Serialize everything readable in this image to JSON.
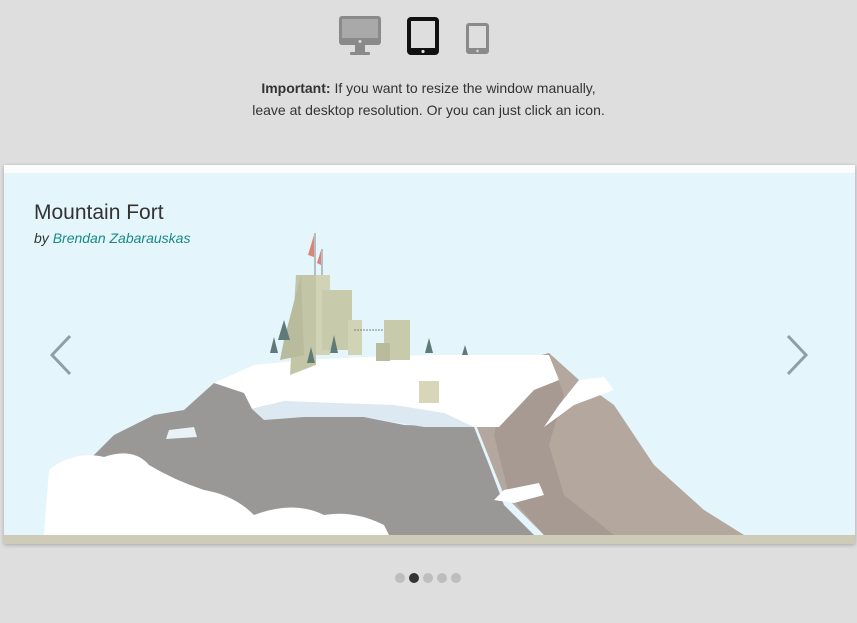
{
  "device_switcher": {
    "items": [
      {
        "name": "desktop",
        "icon": "desktop-monitor-icon",
        "active": false,
        "color": "#8a8a8a"
      },
      {
        "name": "tablet",
        "icon": "tablet-icon",
        "active": true,
        "color": "#111111"
      },
      {
        "name": "phone",
        "icon": "phone-icon",
        "active": false,
        "color": "#8a8a8a"
      }
    ]
  },
  "notice": {
    "strong": "Important:",
    "line1": "If you want to resize the window manually,",
    "line2": "leave at desktop resolution. Or you can just click an icon."
  },
  "slide": {
    "title": "Mountain Fort",
    "by_prefix": "by",
    "author": "Brendan Zabarauskas",
    "author_color": "#1a8a86"
  },
  "navigation": {
    "prev_icon": "chevron-left-icon",
    "next_icon": "chevron-right-icon"
  },
  "pagination": {
    "total": 5,
    "active_index": 1
  },
  "colors": {
    "page_bg": "#dedede",
    "sky": "#e4f5fc",
    "rock": "#9a9896",
    "rock_brown": "#b3a79e",
    "snow": "#ffffff",
    "castle": "#c7cab0",
    "flag": "#d9857a",
    "tree": "#5f7a78"
  }
}
